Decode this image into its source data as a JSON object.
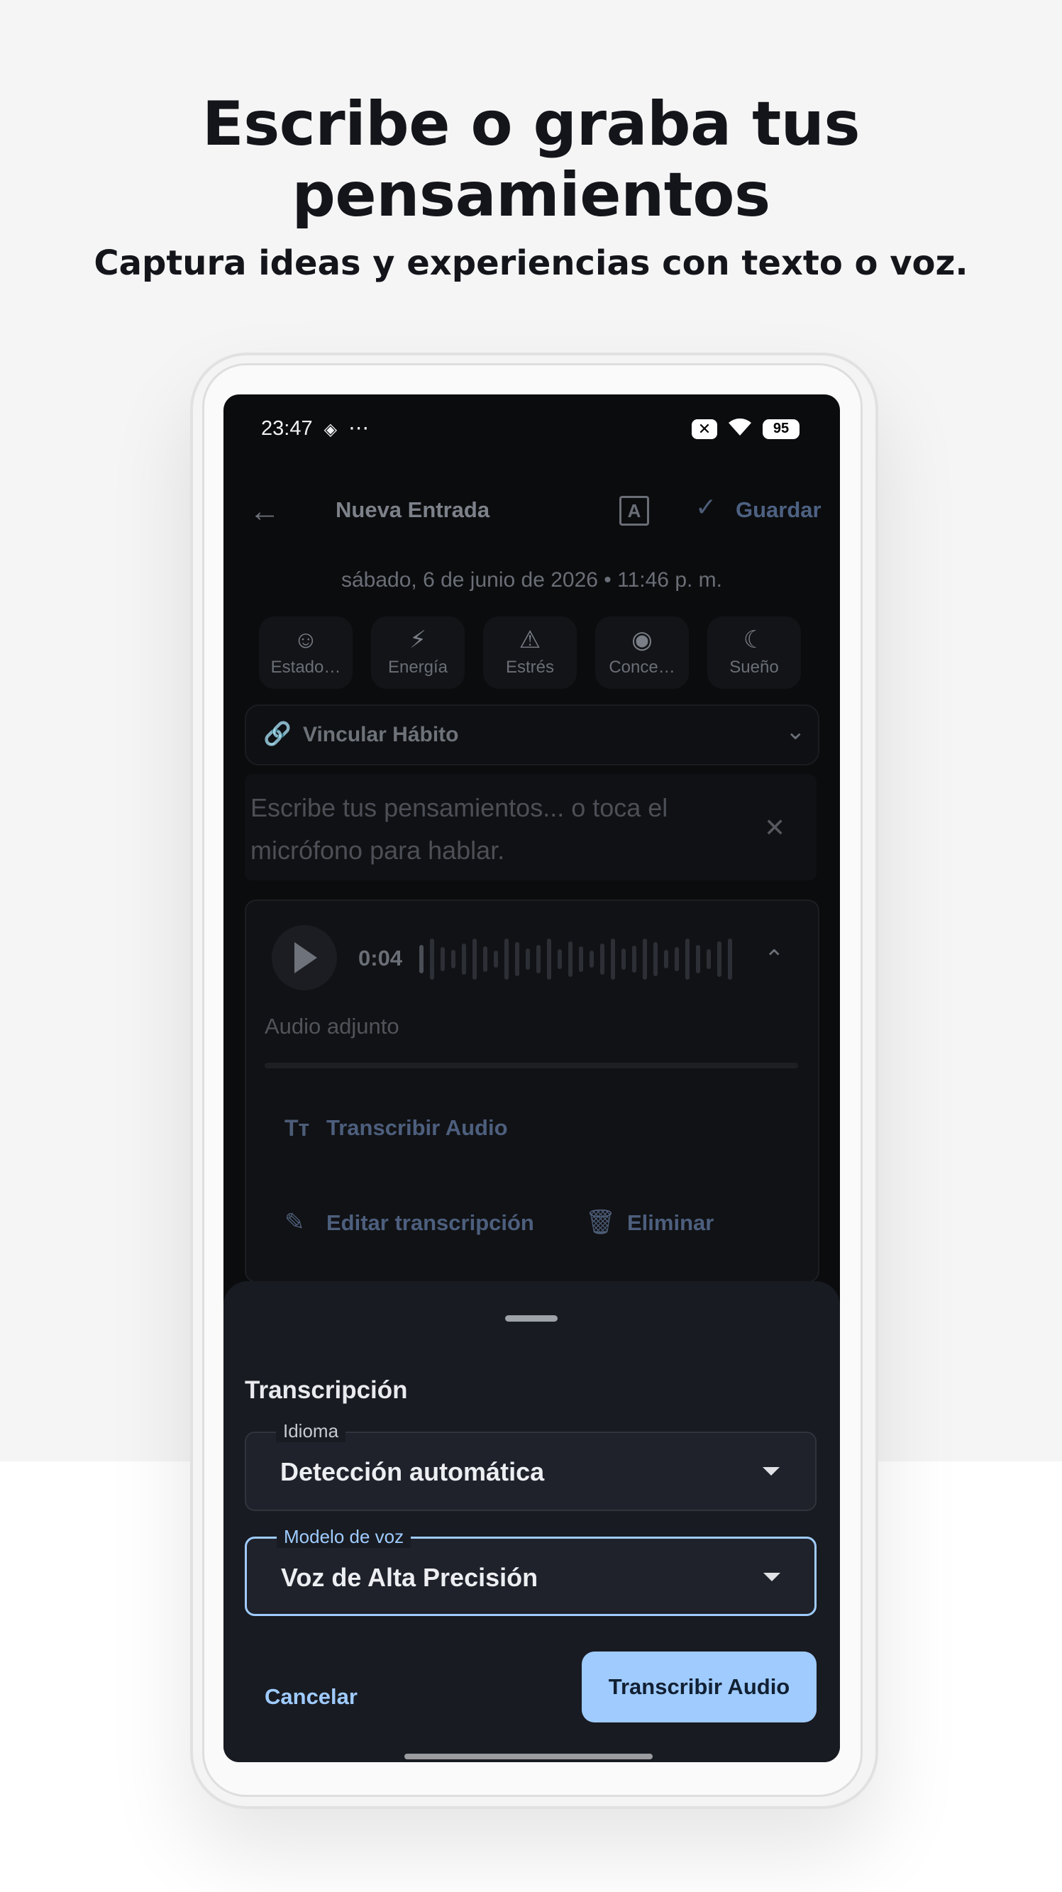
{
  "promo": {
    "headline": "Escribe o graba tus pensamientos",
    "subheadline": "Captura ideas y experiencias con texto o voz."
  },
  "status_bar": {
    "time": "23:47",
    "battery": "95"
  },
  "top_bar": {
    "title": "Nueva Entrada",
    "save_label": "Guardar"
  },
  "entry": {
    "date": "sábado, 6 de junio de 2026 • 11:46 p. m.",
    "metrics": [
      {
        "label": "Estado…",
        "icon": "smiley-icon"
      },
      {
        "label": "Energía",
        "icon": "bolt-icon"
      },
      {
        "label": "Estrés",
        "icon": "warning-icon"
      },
      {
        "label": "Conce…",
        "icon": "focus-icon"
      },
      {
        "label": "Sueño",
        "icon": "moon-icon"
      }
    ],
    "habit_link_label": "Vincular Hábito",
    "text_placeholder": "Escribe tus pensamientos... o toca el micrófono para hablar."
  },
  "audio": {
    "duration": "0:04",
    "attached_label": "Audio adjunto",
    "transcribe_label": "Transcribir Audio",
    "edit_label": "Editar transcripción",
    "delete_label": "Eliminar"
  },
  "sheet": {
    "title": "Transcripción",
    "language_label": "Idioma",
    "language_value": "Detección automática",
    "model_label": "Modelo de voz",
    "model_value": "Voz de Alta Precisión",
    "cancel_label": "Cancelar",
    "confirm_label": "Transcribir Audio"
  },
  "colors": {
    "accent": "#9fcbff",
    "sheet_bg": "#181b21",
    "screen_bg": "#0b0c0e"
  }
}
